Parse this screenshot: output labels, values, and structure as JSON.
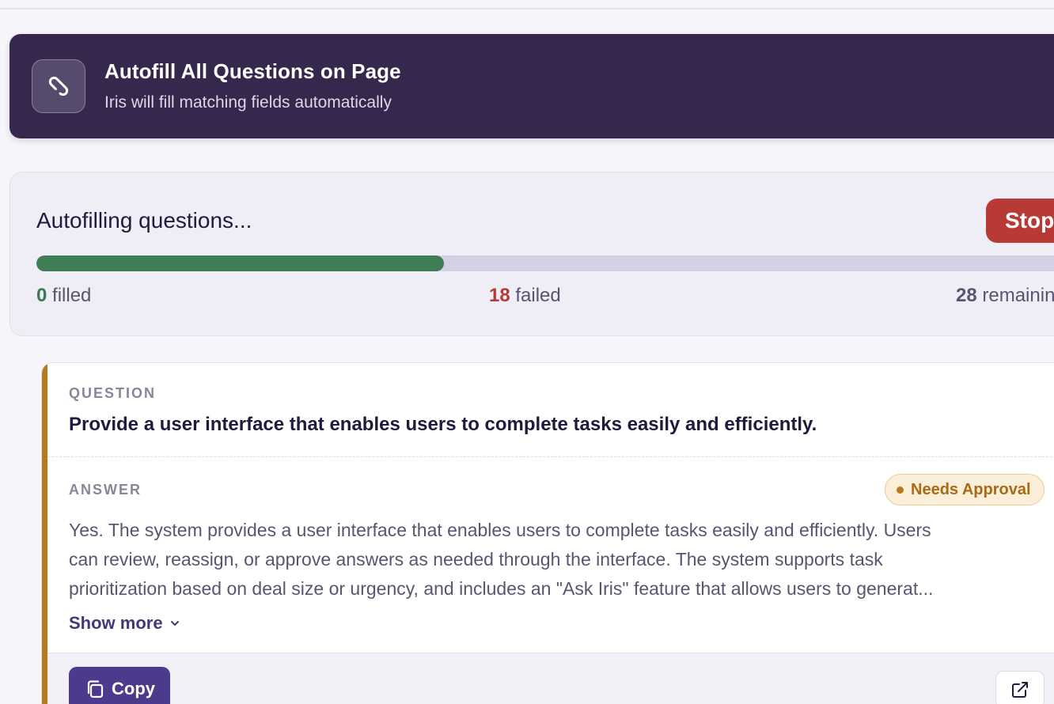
{
  "banner": {
    "icon": "paperclip-icon",
    "title": "Autofill All Questions on Page",
    "subtitle": "Iris will fill matching fields automatically"
  },
  "progress": {
    "title": "Autofilling questions...",
    "stop_label": "Stop",
    "fraction": 0.39,
    "filled_count": "0",
    "filled_label": "filled",
    "failed_count": "18",
    "failed_label": "failed",
    "remaining_count": "28",
    "remaining_label": "remaining"
  },
  "question_card": {
    "question_label": "QUESTION",
    "question_text": "Provide a user interface that enables users to complete tasks easily and efficiently.",
    "answer_label": "ANSWER",
    "status_badge": "Needs Approval",
    "answer_lines": [
      "Yes. The system provides a user interface that enables users to complete tasks easily and efficiently. Users",
      "can review, reassign, or approve answers as needed through the interface. The system supports task",
      "prioritization based on deal size or urgency, and includes an \"Ask Iris\" feature that allows users to generat..."
    ],
    "show_more_label": "Show more",
    "copy_label": "Copy"
  },
  "colors": {
    "banner_bg": "#35284c",
    "progress_fill": "#3e7d55",
    "stop_button": "#b83a36",
    "accent_needs_approval": "#b7791f",
    "primary": "#4c3b8c"
  }
}
